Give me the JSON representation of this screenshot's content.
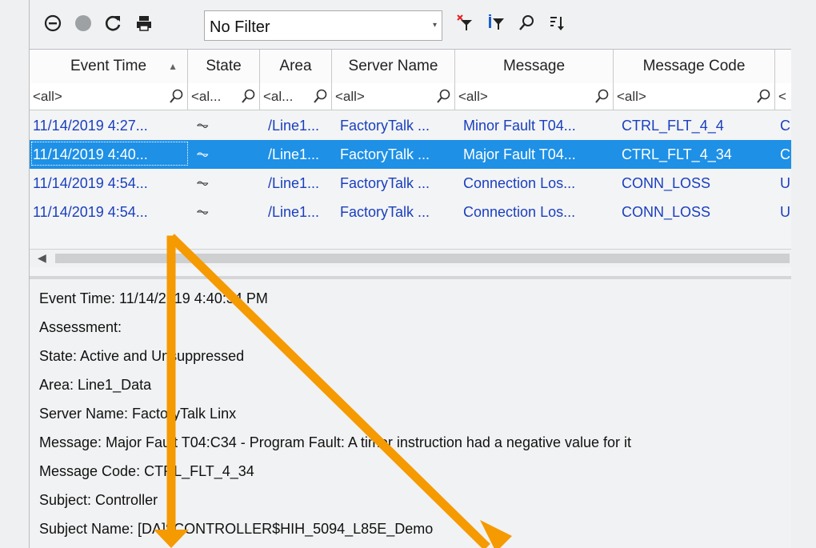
{
  "toolbar": {
    "icons": [
      "stop-circle-icon",
      "shelve-icon",
      "refresh-icon",
      "print-icon",
      "filter-clear-icon",
      "filter-icon",
      "search-icon",
      "sort-icon"
    ],
    "filter_value": "No Filter"
  },
  "table": {
    "headers": [
      "Event Time",
      "State",
      "Area",
      "Server Name",
      "Message",
      "Message Code"
    ],
    "filters": [
      "<all>",
      "<al...",
      "<al...",
      "<all>",
      "<all>",
      "<all>",
      "<"
    ],
    "rows": [
      {
        "time": "11/14/2019 4:27...",
        "state": "⏦",
        "area": "/Line1...",
        "server": "FactoryTalk ...",
        "message": "Minor Fault T04...",
        "code": "CTRL_FLT_4_4",
        "extra": "C"
      },
      {
        "time": "11/14/2019 4:40...",
        "state": "⏦",
        "area": "/Line1...",
        "server": "FactoryTalk ...",
        "message": "Major Fault T04...",
        "code": "CTRL_FLT_4_34",
        "extra": "C"
      },
      {
        "time": "11/14/2019 4:54...",
        "state": "⏦",
        "area": "/Line1...",
        "server": "FactoryTalk ...",
        "message": "Connection Los...",
        "code": "CONN_LOSS",
        "extra": "U"
      },
      {
        "time": "11/14/2019 4:54...",
        "state": "⏦",
        "area": "/Line1...",
        "server": "FactoryTalk ...",
        "message": "Connection Los...",
        "code": "CONN_LOSS",
        "extra": "U"
      }
    ],
    "selected_row": 1
  },
  "details": {
    "lines": [
      "Event Time: 11/14/2019 4:40:34 PM",
      "Assessment:",
      "State: Active and Unsuppressed",
      "Area: Line1_Data",
      "Server Name: FactoryTalk Linx",
      "Message: Major Fault T04:C34 - Program Fault: A timer instruction had a negative value for it",
      "Message Code: CTRL_FLT_4_34",
      "Subject: Controller",
      "Subject Name: [DA]$CONTROLLER$HIH_5094_L85E_Demo"
    ]
  },
  "colors": {
    "selection": "#1e90e6",
    "row_text": "#1a3fbf",
    "arrow": "#f59a00"
  }
}
